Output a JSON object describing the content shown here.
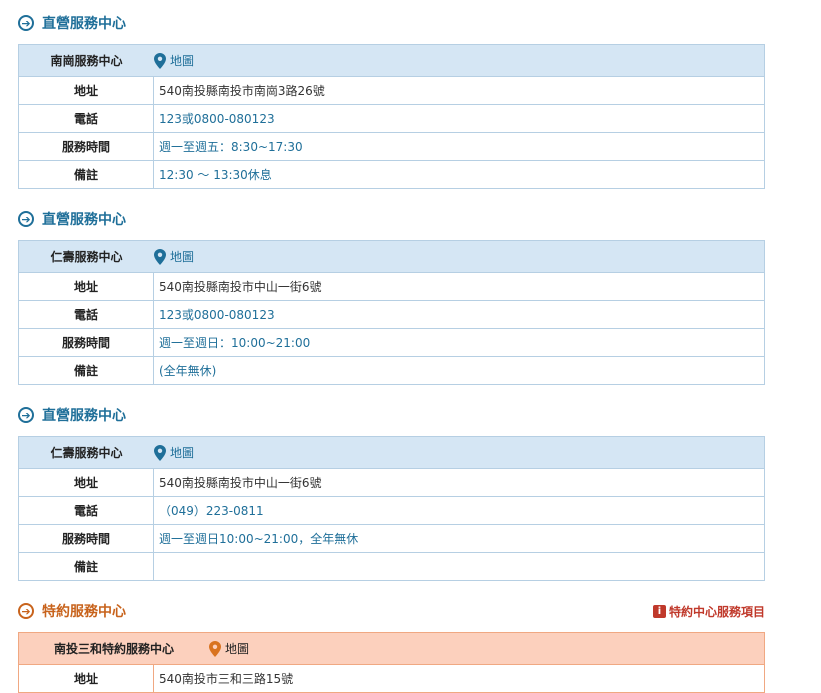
{
  "sections": [
    {
      "title": "直營服務中心",
      "name": "南崗服務中心",
      "map_label": "地圖",
      "rows": [
        {
          "label": "地址",
          "value": "540南投縣南投市南崗3路26號"
        },
        {
          "label": "電話",
          "value": "123或0800-080123"
        },
        {
          "label": "服務時間",
          "value": "週一至週五：8:30~17:30"
        },
        {
          "label": "備註",
          "value": "12:30 ～ 13:30休息"
        }
      ]
    },
    {
      "title": "直營服務中心",
      "name": "仁壽服務中心",
      "map_label": "地圖",
      "rows": [
        {
          "label": "地址",
          "value": "540南投縣南投市中山一街6號"
        },
        {
          "label": "電話",
          "value": "123或0800-080123"
        },
        {
          "label": "服務時間",
          "value": "週一至週日：10:00~21:00"
        },
        {
          "label": "備註",
          "value": "(全年無休)"
        }
      ]
    },
    {
      "title": "直營服務中心",
      "name": "仁壽服務中心",
      "map_label": "地圖",
      "rows": [
        {
          "label": "地址",
          "value": "540南投縣南投市中山一街6號"
        },
        {
          "label": "電話",
          "value": "（049）223-0811"
        },
        {
          "label": "服務時間",
          "value": "週一至週日10:00~21:00，全年無休"
        },
        {
          "label": "備註",
          "value": ""
        }
      ]
    },
    {
      "title": "特約服務中心",
      "link_label": "特約中心服務項目",
      "name": "南投三和特約服務中心",
      "map_label": "地圖",
      "rows": [
        {
          "label": "地址",
          "value": "540南投市三和三路15號"
        }
      ]
    }
  ],
  "icons": {
    "section_arrow": "arrow-right-circle-icon",
    "map": "map-pin-icon",
    "info": "info-icon"
  },
  "colors": {
    "blue_accent": "#1f6f99",
    "orange_accent": "#c8631c",
    "blue_header_bg": "#d5e6f4",
    "orange_header_bg": "#fcd0bd",
    "link_red": "#c0392b"
  }
}
